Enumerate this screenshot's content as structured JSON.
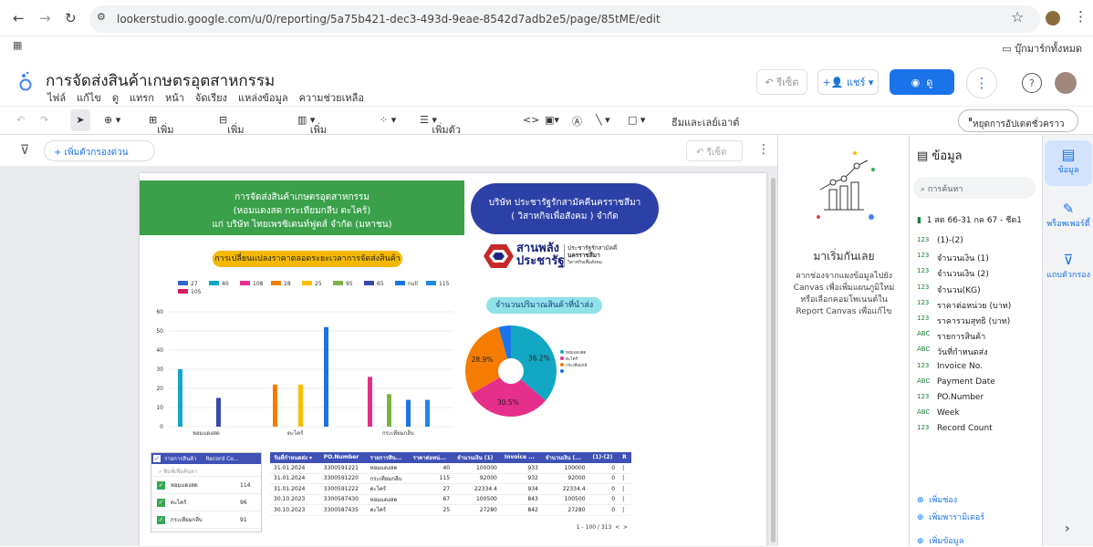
{
  "browser": {
    "url": "lookerstudio.google.com/u/0/reporting/5a75b421-dec3-493d-9eae-8542d7adb2e5/page/85tME/edit",
    "bookmarks_label": "บุ๊กมาร์กทั้งหมด"
  },
  "app": {
    "title": "การจัดส่งสินค้าเกษตรอุตสาหกรรม",
    "menu": [
      "ไฟล์",
      "แก้ไข",
      "ดู",
      "แทรก",
      "หน้า",
      "จัดเรียง",
      "แหล่งข้อมูล",
      "ความช่วยเหลือ"
    ],
    "reset_label": "รีเซ็ต",
    "share_label": "แชร์",
    "view_label": "ดู"
  },
  "toolbar": {
    "add_page": "เพิ่มหน้า",
    "add_data": "เพิ่มข้อมูล",
    "add_chart": "เพิ่มแผนภูมิ",
    "add_control": "เพิ่มตัวควบคุม",
    "theme_layout": "ธีมและเลย์เอาต์",
    "pause_updates": "หยุดการอัปเดตชั่วคราว"
  },
  "filterbar": {
    "add_filter": "+ เพิ่มตัวกรองด่วน",
    "reset": "รีเซ็ต"
  },
  "report": {
    "green_banner": [
      "การจัดส่งสินค้าเกษตรอุตสาหกรรม",
      "(หอมแดงสด กระเทียมกลีบ ตะไคร้)",
      "แก่ บริษัท ไทยเพรซิเดนท์ฟูดส์ จำกัด (มหาชน)"
    ],
    "blue_banner": [
      "บริษัท ประชารัฐรักสามัคคีนครราชสีมา",
      "( วิสาหกิจเพื่อสังคม ) จำกัด"
    ],
    "logo_text": [
      "สานพลัง",
      "ประชารัฐ"
    ],
    "logo_side": [
      "ประชารัฐรักสามัคคี",
      "นครราชสีมา",
      "วิสาหกิจเพื่อสังคม"
    ],
    "bar_title": "การเปลี่ยนแปลงราคาตลอดระยะเวลาการจัดส่งสินค้า",
    "pie_title": "จำนวนปริมาณสินค้าที่นำส่ง",
    "filter_table": {
      "headers": [
        "รายการสินค้า",
        "Record Co..."
      ],
      "search_placeholder": "พิมพ์เพื่อค้นหา",
      "rows": [
        {
          "name": "หอมแดงสด",
          "count": "114"
        },
        {
          "name": "ตะไคร้",
          "count": "96"
        },
        {
          "name": "กระเทียมกลีบ",
          "count": "91"
        }
      ]
    },
    "data_table": {
      "headers": [
        "วันที่กำหนดส่ง ▾",
        "PO.Number",
        "รายการสิน...",
        "ราคาต่อหน่...",
        "จำนวนเงิน (1)",
        "Invoice ...",
        "จำนวนเงิน (...",
        "(1)-(2)",
        "R"
      ],
      "rows": [
        [
          "31.01.2024",
          "3300591221",
          "หอมแดงสด",
          "40",
          "100000",
          "933",
          "100000",
          "0",
          "|"
        ],
        [
          "31.01.2024",
          "3300591220",
          "กระเทียมกลีบ",
          "115",
          "92000",
          "932",
          "92000",
          "0",
          "|"
        ],
        [
          "31.01.2024",
          "3300591222",
          "ตะไคร้",
          "27",
          "22334.4",
          "934",
          "22334.4",
          "0",
          "|"
        ],
        [
          "30.10.2023",
          "3300587430",
          "หอมแดงสด",
          "67",
          "100500",
          "843",
          "100500",
          "0",
          "|"
        ],
        [
          "30.10.2023",
          "3300587435",
          "ตะไคร้",
          "25",
          "27280",
          "842",
          "27280",
          "0",
          "|"
        ]
      ],
      "pagination": "1 - 100 / 313"
    }
  },
  "chart_data": [
    {
      "type": "bar",
      "categories": [
        "หอมแดงสด",
        "ตะไคร้",
        "กระเทียมกลีบ"
      ],
      "series": [
        {
          "name": "27",
          "color": "#3366cc",
          "values": [
            0,
            0,
            0
          ]
        },
        {
          "name": "40",
          "color": "#12a8c4",
          "values": [
            30,
            0,
            0
          ]
        },
        {
          "name": "108",
          "color": "#e62e8b",
          "values": [
            0,
            0,
            26
          ]
        },
        {
          "name": "28",
          "color": "#f57c00",
          "values": [
            0,
            22,
            0
          ]
        },
        {
          "name": "25",
          "color": "#fbbc04",
          "values": [
            0,
            22,
            0
          ]
        },
        {
          "name": "95",
          "color": "#7cb342",
          "values": [
            0,
            0,
            17
          ]
        },
        {
          "name": "65",
          "color": "#3949ab",
          "values": [
            15,
            0,
            0
          ]
        },
        {
          "name": "null",
          "color": "#1a73e8",
          "values": [
            0,
            52,
            14
          ]
        },
        {
          "name": "115",
          "color": "#1e88e5",
          "values": [
            0,
            0,
            14
          ]
        },
        {
          "name": "105",
          "color": "#d81b60",
          "values": [
            0,
            0,
            0
          ]
        }
      ],
      "ylim": [
        0,
        60
      ],
      "yticks": [
        0,
        10,
        20,
        30,
        40,
        50,
        60
      ],
      "grid": true,
      "legend": "top"
    },
    {
      "type": "pie",
      "labels": [
        "หอมแดงสด",
        "ตะไคร้",
        "กระเทียมกลีบ",
        "null"
      ],
      "values": [
        36.2,
        30.5,
        28.9,
        4.4
      ],
      "colors": [
        "#12a8c4",
        "#e62e8b",
        "#f57c00",
        "#1a73e8"
      ],
      "data_labels": [
        "36.2%",
        "30.5%",
        "28.9%",
        ""
      ],
      "legend": "right",
      "donut": true
    }
  ],
  "start_panel": {
    "heading": "มาเริ่มกันเลย",
    "body": "ลากช่องจากแผงข้อมูลไปยัง Canvas เพื่อเพิ่มแผนภูมิใหม่ หรือเลือกคอมโพเนนต์ใน Report Canvas เพื่อแก้ไข"
  },
  "data_panel": {
    "title": "ข้อมูล",
    "search_placeholder": "การค้นหา",
    "source": "1 สต 66-31 กค 67 - ชีต1",
    "fields": [
      {
        "type": "123",
        "name": "(1)-(2)"
      },
      {
        "type": "123",
        "name": "จำนวนเงิน (1)"
      },
      {
        "type": "123",
        "name": "จำนวนเงิน (2)"
      },
      {
        "type": "123",
        "name": "จำนวน(KG)"
      },
      {
        "type": "123",
        "name": "ราคาต่อหน่วย (บาท)"
      },
      {
        "type": "123",
        "name": "ราคารวมสุทธิ (บาท)"
      },
      {
        "type": "ABC",
        "name": "รายการสินค้า"
      },
      {
        "type": "ABC",
        "name": "วันที่กำหนดส่ง"
      },
      {
        "type": "123",
        "name": "Invoice No."
      },
      {
        "type": "ABC",
        "name": "Payment Date"
      },
      {
        "type": "123",
        "name": "PO.Number"
      },
      {
        "type": "ABC",
        "name": "Week"
      },
      {
        "type": "123",
        "name": "Record Count"
      }
    ],
    "add_field": "เพิ่มช่อง",
    "add_parameter": "เพิ่มพารามิเตอร์",
    "add_data": "เพิ่มข้อมูล"
  },
  "rail": {
    "data": "ข้อมูล",
    "properties": "พร็อพเพอร์ตี้",
    "filters": "แถบตัวกรอง"
  }
}
